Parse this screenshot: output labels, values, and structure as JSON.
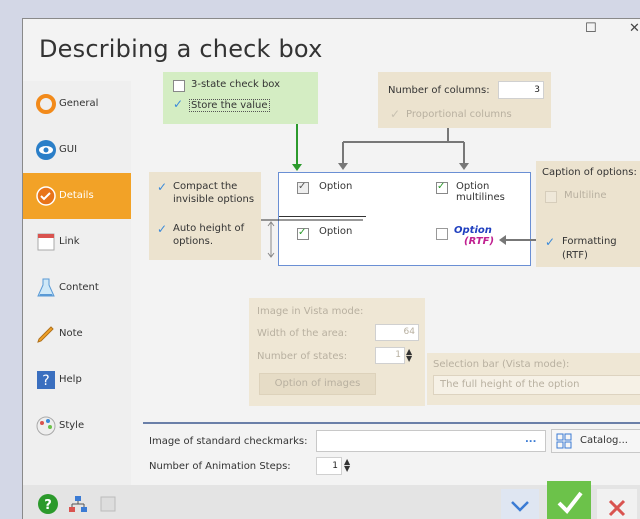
{
  "window": {
    "title": "Describing a check box",
    "maximize": "☐",
    "close": "✕"
  },
  "sidebar": {
    "items": [
      {
        "label": "General",
        "icon": "general-icon"
      },
      {
        "label": "GUI",
        "icon": "eye-icon"
      },
      {
        "label": "Details",
        "icon": "details-icon",
        "active": true
      },
      {
        "label": "Link",
        "icon": "link-icon"
      },
      {
        "label": "Content",
        "icon": "flask-icon"
      },
      {
        "label": "Note",
        "icon": "pencil-icon"
      },
      {
        "label": "Help",
        "icon": "help-icon"
      },
      {
        "label": "Style",
        "icon": "palette-icon"
      }
    ]
  },
  "details": {
    "three_state": "3-state check box",
    "store_value": "Store the value",
    "num_columns_label": "Number of columns:",
    "num_columns_value": "3",
    "proportional": "Proportional columns",
    "compact_1": "Compact the",
    "compact_2": "invisible options",
    "autoheight_1": "Auto height of",
    "autoheight_2": "options.",
    "caption_title": "Caption of options:",
    "multiline": "Multiline",
    "formatting_1": "Formatting",
    "formatting_2": "(RTF)",
    "preview": {
      "option": "Option",
      "multi_1": "Option",
      "multi_2": "multilines",
      "rtf_1": "Option",
      "rtf_2": "(RTF)"
    },
    "vista_title": "Image in Vista mode:",
    "width_label": "Width of the area:",
    "width_value": "64",
    "states_label": "Number of states:",
    "states_value": "1",
    "images_button": "Option of images",
    "selbar_title": "Selection bar (Vista mode):",
    "selbar_value": "The full height of the option",
    "std_image_label": "Image of standard checkmarks:",
    "browse": "...",
    "catalog": "Catalog...",
    "anim_label": "Number of Animation Steps:",
    "anim_value": "1"
  },
  "colors": {
    "accent": "#f2a227",
    "ok": "#6cc24a",
    "cancel": "#d9534f",
    "link": "#3b8ad9"
  }
}
